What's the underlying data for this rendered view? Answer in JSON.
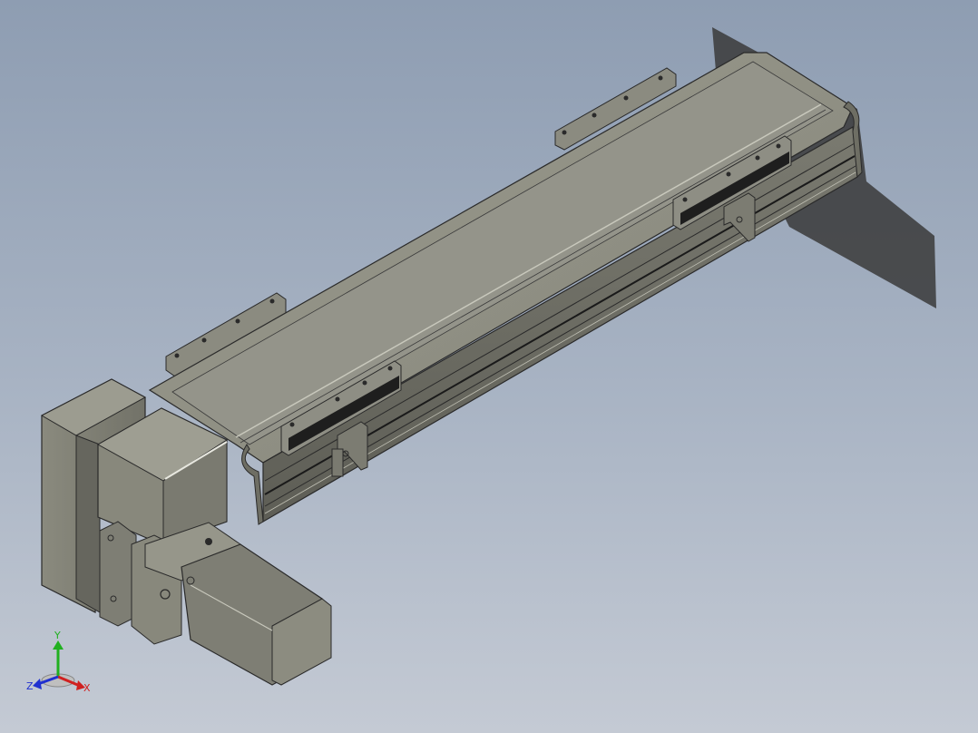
{
  "viewport": {
    "background_top": "#8e9db2",
    "background_bottom": "#c4cad4",
    "model": "linear-actuator-with-motor"
  },
  "triad": {
    "x_label": "X",
    "y_label": "Y",
    "z_label": "Z",
    "x_color": "#d02020",
    "y_color": "#20b020",
    "z_color": "#2030d0"
  }
}
